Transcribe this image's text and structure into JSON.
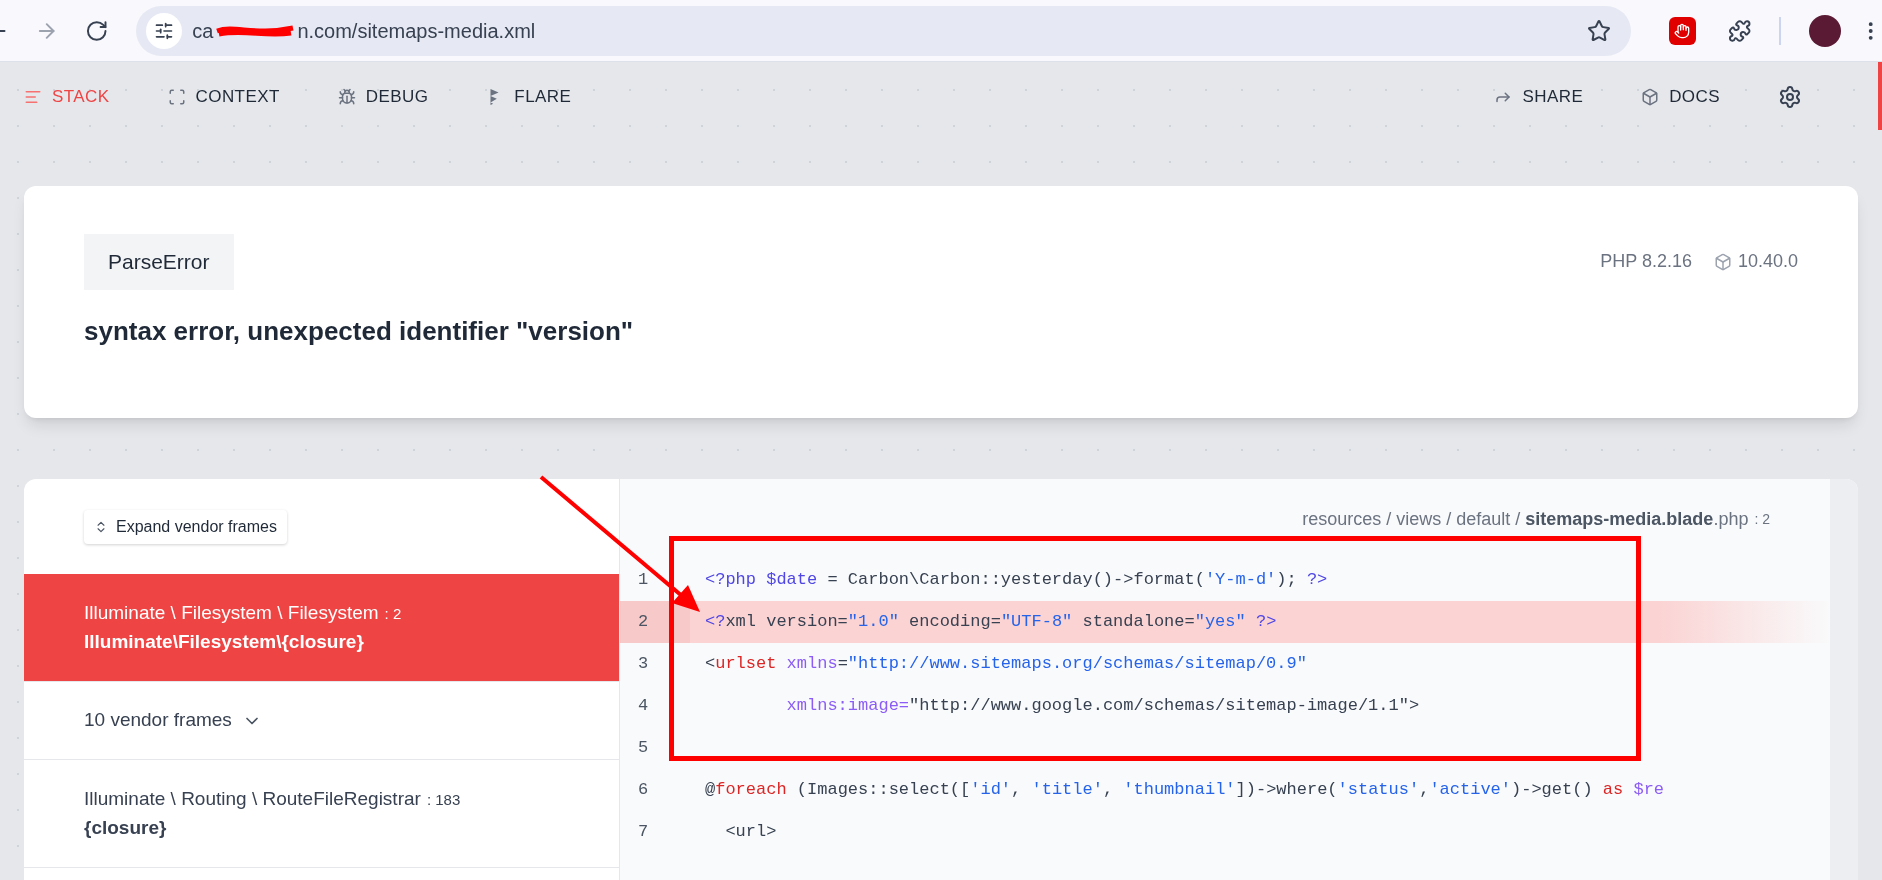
{
  "browser": {
    "url_start": "ca",
    "url_end": "n.com/sitemaps-media.xml"
  },
  "nav": {
    "left": [
      {
        "label": "STACK",
        "selected": true,
        "kind": "stack"
      },
      {
        "label": "CONTEXT",
        "selected": false,
        "kind": "context"
      },
      {
        "label": "DEBUG",
        "selected": false,
        "kind": "debug"
      },
      {
        "label": "FLARE",
        "selected": false,
        "kind": "flare"
      }
    ],
    "right": [
      {
        "label": "SHARE",
        "kind": "share"
      },
      {
        "label": "DOCS",
        "kind": "docs"
      }
    ]
  },
  "error": {
    "type": "ParseError",
    "message": "syntax error, unexpected identifier \"version\"",
    "php_version": "PHP 8.2.16",
    "laravel_version": "10.40.0"
  },
  "frames": {
    "expand_button": "Expand vendor frames",
    "items": [
      {
        "kind": "frame",
        "class": "Illuminate \\ Filesystem \\ Filesystem",
        "line": ": 2",
        "method": "Illuminate\\Filesystem\\{closure}",
        "selected": true
      },
      {
        "kind": "vendor",
        "label": "10 vendor frames"
      },
      {
        "kind": "frame",
        "class": "Illuminate \\ Routing \\ RouteFileRegistrar",
        "line": ": 183",
        "method": "{closure}",
        "selected": false
      }
    ]
  },
  "code": {
    "path_dirs": "resources / views / default / ",
    "path_file": "sitemaps-media.blade",
    "path_ext": ".php",
    "path_line": ": 2",
    "lines": [
      {
        "number": "1",
        "highlighted": false,
        "tokens": [
          {
            "kind": "tag",
            "text": "<?php $date"
          },
          {
            "kind": "plain",
            "text": " = Carbon\\Carbon::yesterday()->format("
          },
          {
            "kind": "string",
            "text": "'Y-m-d'"
          },
          {
            "kind": "plain",
            "text": "); "
          },
          {
            "kind": "tag",
            "text": "?>"
          }
        ]
      },
      {
        "number": "2",
        "highlighted": true,
        "tokens": [
          {
            "kind": "tag",
            "text": "<?"
          },
          {
            "kind": "plain",
            "text": "xml version="
          },
          {
            "kind": "string",
            "text": "\"1.0\""
          },
          {
            "kind": "plain",
            "text": " encoding="
          },
          {
            "kind": "string",
            "text": "\"UTF-8\""
          },
          {
            "kind": "plain",
            "text": " standalone="
          },
          {
            "kind": "string",
            "text": "\"yes\""
          },
          {
            "kind": "tag",
            "text": " ?>"
          }
        ]
      },
      {
        "number": "3",
        "highlighted": false,
        "tokens": [
          {
            "kind": "plain",
            "text": "<"
          },
          {
            "kind": "keyword",
            "text": "urlset"
          },
          {
            "kind": "attr",
            "text": " xmlns"
          },
          {
            "kind": "plain",
            "text": "="
          },
          {
            "kind": "string",
            "text": "\"http://www.sitemaps.org/schemas/sitemap/0.9\""
          }
        ]
      },
      {
        "number": "4",
        "highlighted": false,
        "tokens": [
          {
            "kind": "attr",
            "text": "        xmlns:image="
          },
          {
            "kind": "plain",
            "text": "\"http://www.google.com/schemas/sitemap-image/1.1\">"
          }
        ]
      },
      {
        "number": "5",
        "highlighted": false
      },
      {
        "number": "6",
        "highlighted": false,
        "tokens": [
          {
            "kind": "plain",
            "text": "@"
          },
          {
            "kind": "keyword",
            "text": "foreach"
          },
          {
            "kind": "plain",
            "text": " (Images::select(["
          },
          {
            "kind": "string",
            "text": "'id'"
          },
          {
            "kind": "plain",
            "text": ", "
          },
          {
            "kind": "string",
            "text": "'title'"
          },
          {
            "kind": "plain",
            "text": ", "
          },
          {
            "kind": "string",
            "text": "'thumbnail'"
          },
          {
            "kind": "plain",
            "text": "])->where("
          },
          {
            "kind": "string",
            "text": "'status'"
          },
          {
            "kind": "plain",
            "text": ","
          },
          {
            "kind": "string",
            "text": "'active'"
          },
          {
            "kind": "plain",
            "text": ")->get() "
          },
          {
            "kind": "keyword",
            "text": "as"
          },
          {
            "kind": "attr",
            "text": " $re"
          }
        ]
      },
      {
        "number": "7",
        "highlighted": false,
        "tokens": [
          {
            "kind": "plain",
            "text": "  <url>"
          }
        ]
      }
    ]
  }
}
